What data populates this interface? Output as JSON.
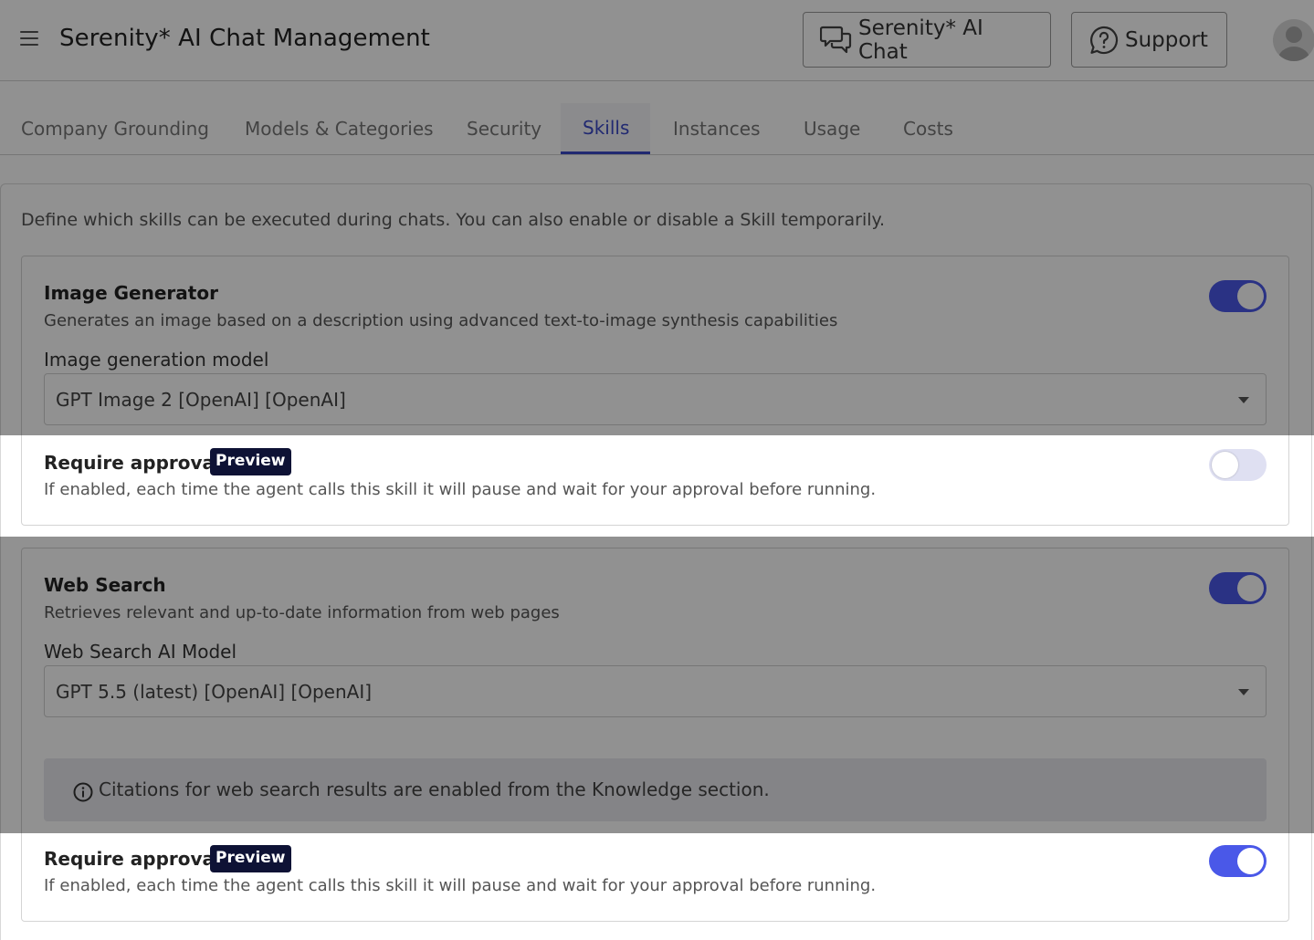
{
  "header": {
    "title": "Serenity* AI Chat Management",
    "chat_button": "Serenity* AI Chat",
    "support_button": "Support"
  },
  "tabs": [
    {
      "label": "Company Grounding",
      "active": false
    },
    {
      "label": "Models & Categories",
      "active": false
    },
    {
      "label": "Security",
      "active": false
    },
    {
      "label": "Skills",
      "active": true
    },
    {
      "label": "Instances",
      "active": false
    },
    {
      "label": "Usage",
      "active": false
    },
    {
      "label": "Costs",
      "active": false
    }
  ],
  "intro": "Define which skills can be executed during chats. You can also enable or disable a Skill temporarily.",
  "skills": [
    {
      "name": "Image Generator",
      "description": "Generates an image based on a description using advanced text-to-image synthesis capabilities",
      "enabled": true,
      "model_label": "Image generation model",
      "model_value": "GPT Image 2 [OpenAI] [OpenAI]",
      "approval_title": "Require approval",
      "approval_badge": "Preview",
      "approval_desc": "If enabled, each time the agent calls this skill it will pause and wait for your approval before running.",
      "approval_enabled": false
    },
    {
      "name": "Web Search",
      "description": "Retrieves relevant and up-to-date information from web pages",
      "enabled": true,
      "model_label": "Web Search AI Model",
      "model_value": "GPT 5.5 (latest) [OpenAI] [OpenAI]",
      "notice": "Citations for web search results are enabled from the Knowledge section.",
      "approval_title": "Require approval",
      "approval_badge": "Preview",
      "approval_desc": "If enabled, each time the agent calls this skill it will pause and wait for your approval before running.",
      "approval_enabled": true
    }
  ],
  "colors": {
    "accent": "#3a49c7",
    "toggle_on": "#4a58e8",
    "badge_bg": "#0e1235"
  }
}
